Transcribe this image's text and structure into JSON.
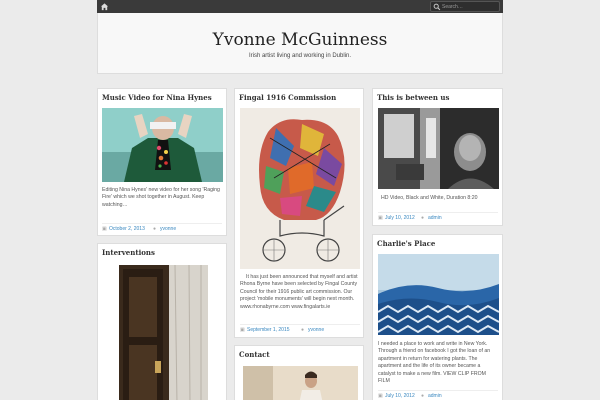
{
  "search": {
    "placeholder": "Search…"
  },
  "site": {
    "title": "Yvonne McGuinness",
    "description": "Irish artist living and working in Dublin."
  },
  "posts": [
    {
      "title": "Music Video for Nina Hynes",
      "excerpt": "Editing Nina Hynes' new video for her song 'Raging Fire' which we shot together in August. Keep watching…",
      "date": "October 2, 2013",
      "author": "yvonne"
    },
    {
      "title": "Fingal 1916 Commission",
      "excerpt": "It has just been announced that myself and artist Rhona Byrne have been selected by Fingal County Council for their 1916 public art commission. Our project 'mobile monuments' will begin next month. www.rhonabyrne.com www.fingalarts.ie",
      "date": "September 1, 2015",
      "author": "yvonne"
    },
    {
      "title": "This is between us",
      "excerpt": "HD Video, Black and White, Duration 8:20",
      "date": "July 10, 2012",
      "author": "admin"
    },
    {
      "title": "Interventions"
    },
    {
      "title": "Contact"
    },
    {
      "title": "Charlie's Place",
      "excerpt": "I needed a place to work and write in New York. Through a friend on facebook I got the loan of an apartment in return for watering plants. The apartment and the life of its owner became a catalyst to make a new film. VIEW CLIP FROM FILM",
      "date": "July 10, 2012",
      "author": "admin"
    }
  ]
}
